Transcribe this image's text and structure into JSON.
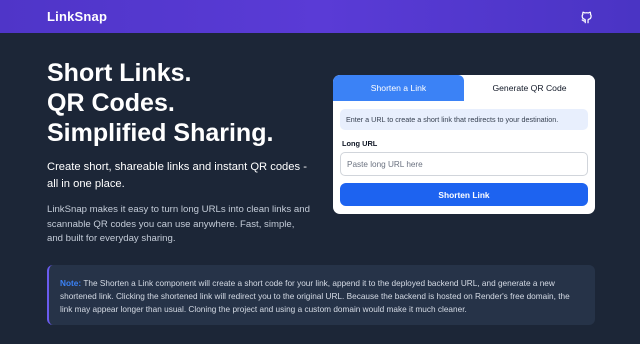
{
  "navbar": {
    "brand": "LinkSnap",
    "github_icon": "github-icon"
  },
  "hero": {
    "title_lines": [
      "Short Links.",
      "QR Codes.",
      "Simplified Sharing."
    ],
    "tagline": "Create short, shareable links and instant QR codes - all in one place.",
    "description": "LinkSnap makes it easy to turn long URLs into clean links and scannable QR codes you can use anywhere. Fast, simple, and built for everyday sharing."
  },
  "card": {
    "tabs": [
      {
        "label": "Shorten a Link",
        "active": true
      },
      {
        "label": "Generate QR Code",
        "active": false
      }
    ],
    "info": "Enter a URL to create a short link that redirects to your destination.",
    "field_label": "Long URL",
    "input": {
      "value": "",
      "placeholder": "Paste long URL here"
    },
    "button_label": "Shorten Link"
  },
  "note": {
    "label": "Note:",
    "text": "The Shorten a Link component will create a short code for your link, append it to the deployed backend URL, and generate a new shortened link. Clicking the shortened link will redirect you to the original URL. Because the backend is hosted on Render's free domain, the link may appear longer than usual. Cloning the project and using a custom domain would make it much cleaner."
  },
  "colors": {
    "background": "#1c2637",
    "navbar_gradient_start": "#4f35c8",
    "accent_blue": "#3b82f6",
    "button_blue": "#1d63f0",
    "note_background": "#263348",
    "note_border": "#6a5cf0"
  }
}
